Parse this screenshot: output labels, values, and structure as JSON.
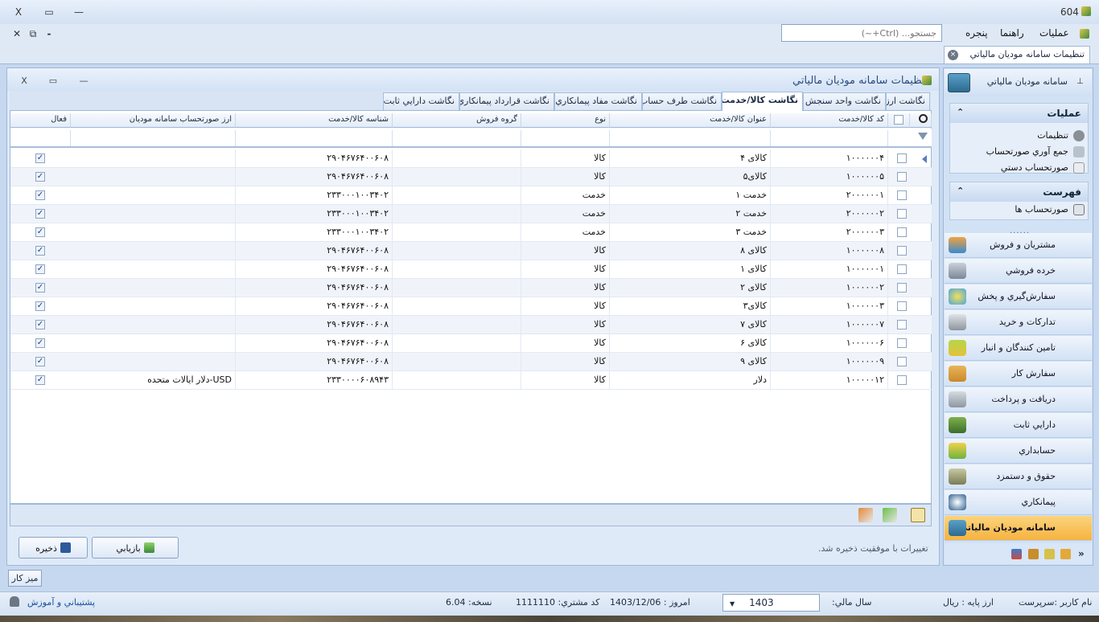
{
  "window": {
    "title": "604",
    "close": "X",
    "maximize": "▭",
    "minimize": "—"
  },
  "inner_ctrl": {
    "close": "✕",
    "restore": "⧉",
    "minimize": "-"
  },
  "search": {
    "placeholder": "جستجو... (Ctrl+~)"
  },
  "menu": {
    "items": [
      "عمليات",
      "راهنما",
      "پنجره"
    ]
  },
  "doc_tab": {
    "label": "تنظيمات سامانه موديان مالياتي",
    "close": "×"
  },
  "sidebar": {
    "header": "سامانه موديان مالياتي",
    "pin": "⊥",
    "groups": [
      {
        "title": "عمليات",
        "chev": "⌃",
        "items": [
          "تنظيمات",
          "جمع آوري صورتحساب",
          "صورتحساب دستي"
        ]
      },
      {
        "title": "فهرست",
        "chev": "⌃",
        "items": [
          "صورتحساب ها"
        ]
      }
    ],
    "dots": "......",
    "modules": [
      "مشتريان و فروش",
      "خرده فروشي",
      "سفارش‌گيري و پخش",
      "تدارکات و خريد",
      "تامين کنندگان و انبار",
      "سفارش کار",
      "دريافت و پرداخت",
      "دارايي ثابت",
      "حسابداري",
      "حقوق و دستمزد",
      "پيمانکاري",
      "سامانه موديان مالياتي"
    ],
    "active_module": "سامانه موديان مالياتي",
    "more": "»"
  },
  "main": {
    "title": "تنظيمات سامانه موديان مالياتي",
    "controls": {
      "close": "X",
      "restore": "▭",
      "minimize": "—"
    },
    "tabs": [
      "نگاشت ارز",
      "نگاشت واحد سنجش",
      "نگاشت کالا/خدمت",
      "نگاشت طرف حساب",
      "نگاشت مفاد پيمانکاري",
      "نگاشت قرارداد پيمانکاري",
      "نگاشت دارايي ثابت"
    ],
    "selected_tab": "نگاشت کالا/خدمت",
    "columns": [
      "کد کالا/خدمت",
      "عنوان کالا/خدمت",
      "نوع",
      "گروه فروش",
      "شناسه کالا/خدمت",
      "ارز صورتحساب سامانه موديان",
      "فعال"
    ],
    "rows": [
      {
        "code": "۱۰۰۰۰۰۰۴",
        "title": "کالای ۴",
        "type": "کالا",
        "group": "",
        "id": "۲۹۰۴۶۷۶۴۰۰۶۰۸",
        "currency": "",
        "active": true
      },
      {
        "code": "۱۰۰۰۰۰۰۵",
        "title": "کالای۵",
        "type": "کالا",
        "group": "",
        "id": "۲۹۰۴۶۷۶۴۰۰۶۰۸",
        "currency": "",
        "active": true
      },
      {
        "code": "۲۰۰۰۰۰۰۱",
        "title": "خدمت ۱",
        "type": "خدمت",
        "group": "",
        "id": "۲۳۳۰۰۰۱۰۰۳۴۰۲",
        "currency": "",
        "active": true
      },
      {
        "code": "۲۰۰۰۰۰۰۲",
        "title": "خدمت ۲",
        "type": "خدمت",
        "group": "",
        "id": "۲۳۳۰۰۰۱۰۰۳۴۰۲",
        "currency": "",
        "active": true
      },
      {
        "code": "۲۰۰۰۰۰۰۳",
        "title": "خدمت ۳",
        "type": "خدمت",
        "group": "",
        "id": "۲۳۳۰۰۰۱۰۰۳۴۰۲",
        "currency": "",
        "active": true
      },
      {
        "code": "۱۰۰۰۰۰۰۸",
        "title": "کالای ۸",
        "type": "کالا",
        "group": "",
        "id": "۲۹۰۴۶۷۶۴۰۰۶۰۸",
        "currency": "",
        "active": true
      },
      {
        "code": "۱۰۰۰۰۰۰۱",
        "title": "کالای ۱",
        "type": "کالا",
        "group": "",
        "id": "۲۹۰۴۶۷۶۴۰۰۶۰۸",
        "currency": "",
        "active": true
      },
      {
        "code": "۱۰۰۰۰۰۰۲",
        "title": "کالای ۲",
        "type": "کالا",
        "group": "",
        "id": "۲۹۰۴۶۷۶۴۰۰۶۰۸",
        "currency": "",
        "active": true
      },
      {
        "code": "۱۰۰۰۰۰۰۳",
        "title": "کالای۳",
        "type": "کالا",
        "group": "",
        "id": "۲۹۰۴۶۷۶۴۰۰۶۰۸",
        "currency": "",
        "active": true
      },
      {
        "code": "۱۰۰۰۰۰۰۷",
        "title": "کالای ۷",
        "type": "کالا",
        "group": "",
        "id": "۲۹۰۴۶۷۶۴۰۰۶۰۸",
        "currency": "",
        "active": true
      },
      {
        "code": "۱۰۰۰۰۰۰۶",
        "title": "کالای ۶",
        "type": "کالا",
        "group": "",
        "id": "۲۹۰۴۶۷۶۴۰۰۶۰۸",
        "currency": "",
        "active": true
      },
      {
        "code": "۱۰۰۰۰۰۰۹",
        "title": "کالای ۹",
        "type": "کالا",
        "group": "",
        "id": "۲۹۰۴۶۷۶۴۰۰۶۰۸",
        "currency": "",
        "active": true
      },
      {
        "code": "۱۰۰۰۰۰۱۲",
        "title": "دلار",
        "type": "کالا",
        "group": "",
        "id": "۲۳۳۰۰۰۰۶۰۸۹۴۳",
        "currency": "دلار ايالات متحده-USD",
        "active": true
      }
    ],
    "save_label": "ذخيره",
    "reset_label": "بازيابي",
    "status_message": "تغييرات با موفقيت ذخيره شد."
  },
  "desk": {
    "label": "ميز کار"
  },
  "statusbar": {
    "user": "نام کاربر :سرپرست",
    "base_currency": "ارز پايه :  ريال",
    "fiscal_year_label": "سال مالي:",
    "fiscal_year": "1403",
    "today": "امروز :   1403/12/06",
    "customer_code": "کد مشتري:   1111110",
    "version": "نسخه:   6.04",
    "support": "پشتيباني و آموزش"
  },
  "colors": {
    "accent": "#2a4b7c",
    "active_module": "#f6b340",
    "link": "#1a4fa0"
  }
}
